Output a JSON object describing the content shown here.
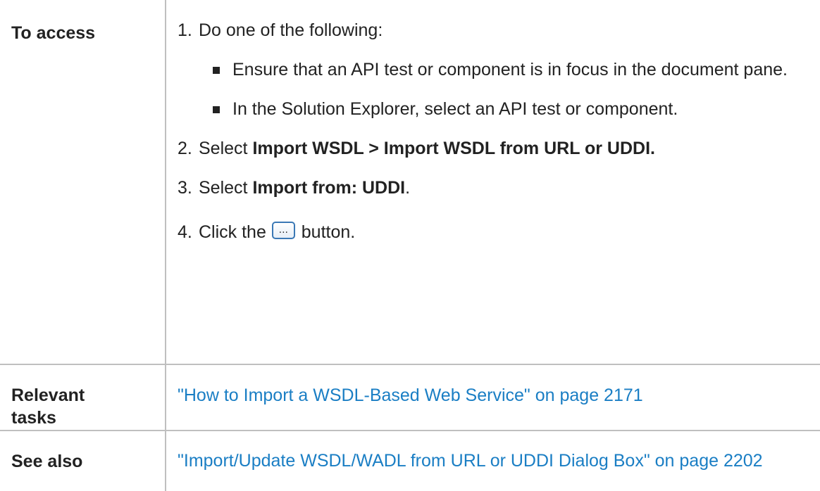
{
  "table": {
    "rows": [
      {
        "label": "To access",
        "steps": {
          "step1": {
            "number": "1.",
            "text": "Do one of the following:"
          },
          "substeps": [
            "Ensure that an API test or component is in focus in the document pane.",
            "In the Solution Explorer, select an API test or component."
          ],
          "step2": {
            "number": "2.",
            "prefix": "Select ",
            "bold": "Import WSDL > Import WSDL from URL or UDDI."
          },
          "step3": {
            "number": "3.",
            "prefix": "Select ",
            "bold": "Import from: UDDI",
            "suffix": "."
          },
          "step4": {
            "number": "4.",
            "prefix": "Click the ",
            "button_glyph": "...",
            "suffix": " button."
          }
        }
      },
      {
        "label": "Relevant tasks",
        "link": "\"How to Import a WSDL-Based Web Service\" on page 2171"
      },
      {
        "label": "See also",
        "link": "\"Import/Update WSDL/WADL from URL or UDDI Dialog Box\" on page 2202"
      }
    ]
  },
  "colors": {
    "link": "#1a7ec4",
    "text": "#222222",
    "border": "#bfbfbf"
  },
  "icons": {
    "browse_button": "ellipsis-button-icon",
    "bullet": "square-bullet-icon"
  }
}
